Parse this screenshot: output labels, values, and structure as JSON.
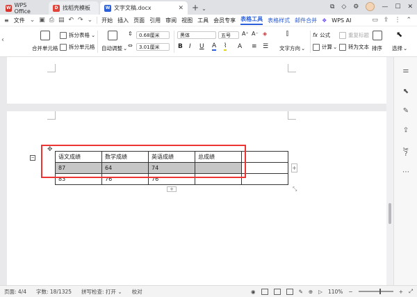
{
  "titlebar": {
    "tabs": [
      {
        "label": "WPS Office",
        "icon": "wps-logo-icon",
        "color": "#d9342b"
      },
      {
        "label": "找稻壳模板",
        "icon": "docer-icon",
        "color": "#e0443a"
      },
      {
        "label": "文字文稿.docx",
        "icon": "writer-doc-icon",
        "color": "#2b5fd9",
        "close": "✕"
      }
    ],
    "plus": "+",
    "chevron": "⌄"
  },
  "menubar": {
    "file_label": "文件",
    "items": [
      "开始",
      "插入",
      "页面",
      "引用",
      "审阅",
      "视图",
      "工具",
      "会员专享"
    ],
    "active": "表格工具",
    "table_style": "表格样式",
    "mail_merge": "邮件合并",
    "wps_ai": "WPS AI"
  },
  "ribbon": {
    "merge_cells": "合并单元格",
    "split_table": "拆分表格",
    "split_cells": "拆分单元格",
    "auto_fit": "自动调整",
    "row_height": "0.68厘米",
    "col_width": "3.01厘米",
    "font_name": "黑体",
    "font_size": "五号",
    "text_direction": "文字方向",
    "formula": "公式",
    "repeat_header": "重复标题",
    "calculate": "计算",
    "to_text": "转为文本",
    "sort": "排序",
    "select": "选择"
  },
  "table": {
    "rows": [
      [
        "语文成绩",
        "数学成绩",
        "英语成绩",
        "总成绩",
        ""
      ],
      [
        "87",
        "64",
        "74",
        "",
        ""
      ],
      [
        "83",
        "76",
        "76",
        "",
        ""
      ]
    ]
  },
  "status": {
    "page": "页面: 4/4",
    "words": "字数: 18/1325",
    "spell": "拼写检查: 打开",
    "proof": "校对",
    "zoom": "110%"
  },
  "colors": {
    "accent": "#2b5fd9",
    "highlight_box": "#e33333",
    "selected_cells": "#c6c6c6"
  }
}
